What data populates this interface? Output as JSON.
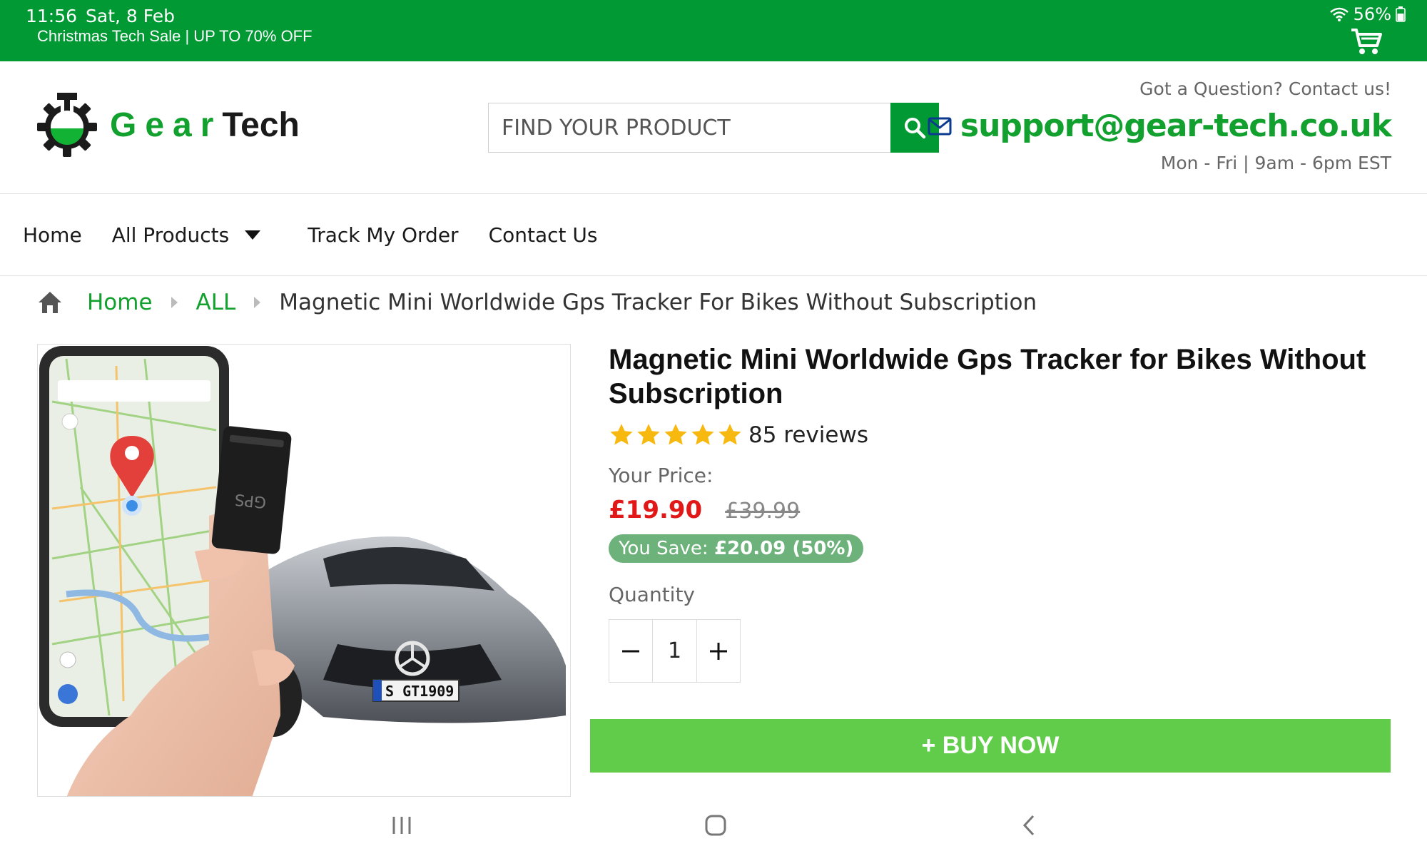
{
  "status_bar": {
    "time": "11:56",
    "date": "Sat, 8 Feb",
    "battery": "56%",
    "promo": "Christmas Tech Sale | UP TO 70% OFF"
  },
  "logo": {
    "word1": "Gear",
    "word2": "Tech"
  },
  "search": {
    "placeholder": "FIND YOUR PRODUCT"
  },
  "contact": {
    "question": "Got a Question? Contact us!",
    "email": "support@gear-tech.co.uk",
    "hours": "Mon - Fri | 9am - 6pm EST"
  },
  "nav": {
    "items": [
      "Home",
      "All Products",
      "Track My Order",
      "Contact Us"
    ]
  },
  "breadcrumb": {
    "home": "Home",
    "category": "ALL",
    "current": "Magnetic Mini Worldwide Gps Tracker For Bikes Without Subscription"
  },
  "product": {
    "title": "Magnetic Mini Worldwide Gps Tracker for Bikes Without Subscription",
    "rating": 5,
    "reviews": "85 reviews",
    "price_label": "Your Price:",
    "price_now": "£19.90",
    "price_was": "£39.99",
    "save_label": "You Save:",
    "save_amount": "£20.09 (50%)",
    "quantity_label": "Quantity",
    "quantity": "1",
    "image_plate": "S GT1909",
    "image_device_label": "GPS"
  },
  "buy_button": {
    "label": "+ BUY NOW"
  },
  "colors": {
    "brand_green": "#009933",
    "logo_green": "#12a12e",
    "buy_green": "#61cc4a",
    "price_red": "#e01818",
    "save_badge": "#6cb27a",
    "star": "#f7b90f"
  }
}
